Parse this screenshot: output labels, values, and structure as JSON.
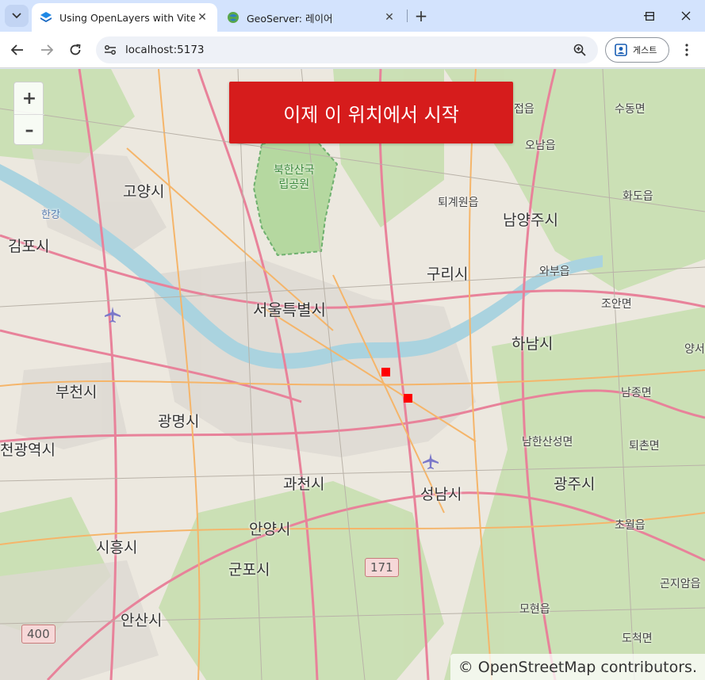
{
  "browser": {
    "tabs": [
      {
        "title": "Using OpenLayers with Vite",
        "active": true,
        "favicon": "openlayers-icon"
      },
      {
        "title": "GeoServer: 레이어",
        "active": false,
        "favicon": "geoserver-icon"
      }
    ],
    "url": "localhost:5173",
    "profile_label": "게스트"
  },
  "map": {
    "zoom_in_label": "+",
    "zoom_out_label": "–",
    "start_button_label": "이제 이 위치에서 시작",
    "attribution": "© OpenStreetMap contributors.",
    "labels": {
      "goyang": "고양시",
      "gimpo": "김포시",
      "bucheon": "부천시",
      "gwangmyeong": "광명시",
      "incheon": "천광역시",
      "siheung": "시흥시",
      "ansan": "안산시",
      "gunpo": "군포시",
      "anyang": "안양시",
      "gwacheon": "과천시",
      "seoul": "서울특별시",
      "guri": "구리시",
      "namyangju": "남양주시",
      "hanam": "하남시",
      "seongnam": "성남시",
      "gwangju": "광주시",
      "bukhansan": "북한산국\n립공원",
      "hangang": "한강",
      "toegyewon": "퇴계원읍",
      "jinjeop": "접읍",
      "onam": "오남읍",
      "sudong": "수동면",
      "hwado": "화도읍",
      "wabu": "와부읍",
      "joan": "조안면",
      "yang": "양서",
      "namjong": "남종면",
      "namhansanseong": "남한산성면",
      "toechon": "퇴촌면",
      "chowol": "초월읍",
      "gonjiam": "곤지암읍",
      "ohyeon": "모현읍",
      "docheok": "도척면",
      "road_171": "171",
      "road_400": "400"
    },
    "markers": 2
  }
}
